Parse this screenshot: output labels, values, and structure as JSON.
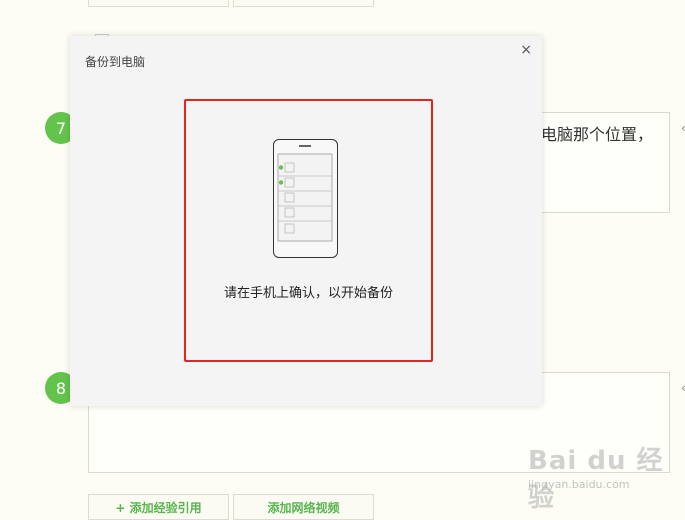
{
  "page": {
    "step7_number": "7",
    "step8_number": "8",
    "step7_visible_text": "电脑那个位置，",
    "add_reference_label": "+ 添加经验引用",
    "add_video_label": "添加网络视频",
    "edge_mark": "‹"
  },
  "dialog": {
    "title": "备份到电脑",
    "close_glyph": "×",
    "prompt": "请在手机上确认，以开始备份"
  },
  "watermark": {
    "main": "Bai du 经验",
    "sub": "jingyan.baidu.com"
  },
  "colors": {
    "accent_green": "#62c44b",
    "highlight_red": "#e5261e",
    "dialog_bg": "#f4f4f4",
    "page_bg": "#fdfdf5"
  }
}
